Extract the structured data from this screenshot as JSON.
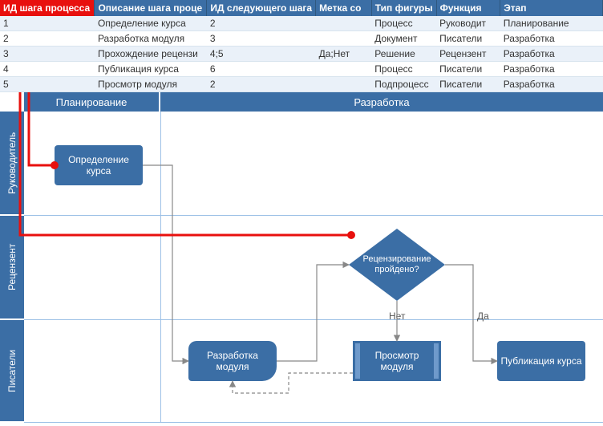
{
  "table": {
    "headers": {
      "id": "ИД шага процесса",
      "desc": "Описание шага проце",
      "next": "ИД следующего шага",
      "label": "Метка со",
      "shape": "Тип фигуры",
      "func": "Функция",
      "phase": "Этап"
    },
    "rows": [
      {
        "id": "1",
        "desc": "Определение курса",
        "next": "2",
        "label": "",
        "shape": "Процесс",
        "func": "Руководит",
        "phase": "Планирование"
      },
      {
        "id": "2",
        "desc": "Разработка модуля",
        "next": "3",
        "label": "",
        "shape": "Документ",
        "func": "Писатели",
        "phase": "Разработка"
      },
      {
        "id": "3",
        "desc": "Прохождение рецензи",
        "next": "4;5",
        "label": "Да;Нет",
        "shape": "Решение",
        "func": "Рецензент",
        "phase": "Разработка"
      },
      {
        "id": "4",
        "desc": "Публикация курса",
        "next": "6",
        "label": "",
        "shape": "Процесс",
        "func": "Писатели",
        "phase": "Разработка"
      },
      {
        "id": "5",
        "desc": "Просмотр модуля",
        "next": "2",
        "label": "",
        "shape": "Подпроцесс",
        "func": "Писатели",
        "phase": "Разработка"
      }
    ]
  },
  "diagram": {
    "phases": {
      "plan": "Планирование",
      "dev": "Разработка"
    },
    "lanes": {
      "mgr": "Руководитель",
      "rev": "Рецензент",
      "wrt": "Писатели"
    },
    "shapes": {
      "define": "Определение курса",
      "develop": "Разработка модуля",
      "review": "Рецензирование пройдено?",
      "inspect": "Просмотр модуля",
      "publish": "Публикация курса"
    },
    "edge_labels": {
      "no": "Нет",
      "yes": "Да"
    }
  },
  "chart_data": {
    "type": "flowchart",
    "phases": [
      "Планирование",
      "Разработка"
    ],
    "swimlanes": [
      "Руководитель",
      "Рецензент",
      "Писатели"
    ],
    "nodes": [
      {
        "id": 1,
        "label": "Определение курса",
        "shape": "process",
        "lane": "Руководитель",
        "phase": "Планирование"
      },
      {
        "id": 2,
        "label": "Разработка модуля",
        "shape": "document",
        "lane": "Писатели",
        "phase": "Разработка"
      },
      {
        "id": 3,
        "label": "Рецензирование пройдено?",
        "shape": "decision",
        "lane": "Рецензент",
        "phase": "Разработка"
      },
      {
        "id": 4,
        "label": "Публикация курса",
        "shape": "process",
        "lane": "Писатели",
        "phase": "Разработка"
      },
      {
        "id": 5,
        "label": "Просмотр модуля",
        "shape": "subprocess",
        "lane": "Писатели",
        "phase": "Разработка"
      }
    ],
    "edges": [
      {
        "from": 1,
        "to": 2,
        "label": ""
      },
      {
        "from": 2,
        "to": 3,
        "label": ""
      },
      {
        "from": 3,
        "to": 5,
        "label": "Нет"
      },
      {
        "from": 3,
        "to": 4,
        "label": "Да"
      },
      {
        "from": 5,
        "to": 2,
        "label": ""
      },
      {
        "from": 4,
        "to": 6,
        "label": ""
      }
    ],
    "highlight_links": [
      {
        "table_row": 1,
        "node": 1
      },
      {
        "table_row": 3,
        "node": 3
      }
    ]
  }
}
